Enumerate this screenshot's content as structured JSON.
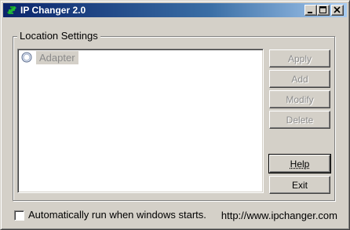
{
  "window": {
    "title": "IP Changer 2.0",
    "title_bar_color": "#0a246a"
  },
  "titlebar": {
    "minimize_icon": "minimize-icon",
    "maximize_icon": "maximize-icon",
    "close_icon": "close-icon"
  },
  "location_settings": {
    "label": "Location Settings",
    "items": [
      {
        "label": "Adapter",
        "icon": "radio-icon",
        "selected": false
      }
    ]
  },
  "buttons": {
    "apply": "Apply",
    "add": "Add",
    "modify": "Modify",
    "delete": "Delete",
    "help": "Help",
    "exit": "Exit"
  },
  "footer": {
    "autorun_label": "Automatically run when windows starts.",
    "autorun_checked": false,
    "website": "http://www.ipchanger.com"
  }
}
